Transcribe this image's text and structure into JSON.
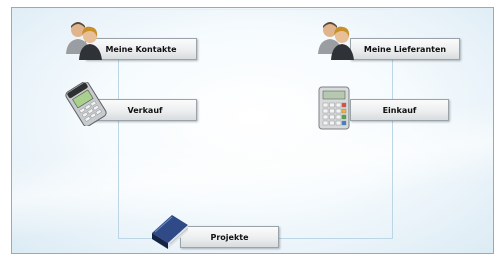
{
  "tiles": {
    "contacts": {
      "label": "Meine Kontakte",
      "icon": "people-icon"
    },
    "suppliers": {
      "label": "Meine Lieferanten",
      "icon": "people-icon"
    },
    "sales": {
      "label": "Verkauf",
      "icon": "payment-terminal-icon"
    },
    "purchase": {
      "label": "Einkauf",
      "icon": "calculator-icon"
    },
    "projects": {
      "label": "Projekte",
      "icon": "book-icon"
    }
  },
  "colors": {
    "connector": "#bcd6e6",
    "frame_border": "#9aa9b3"
  }
}
